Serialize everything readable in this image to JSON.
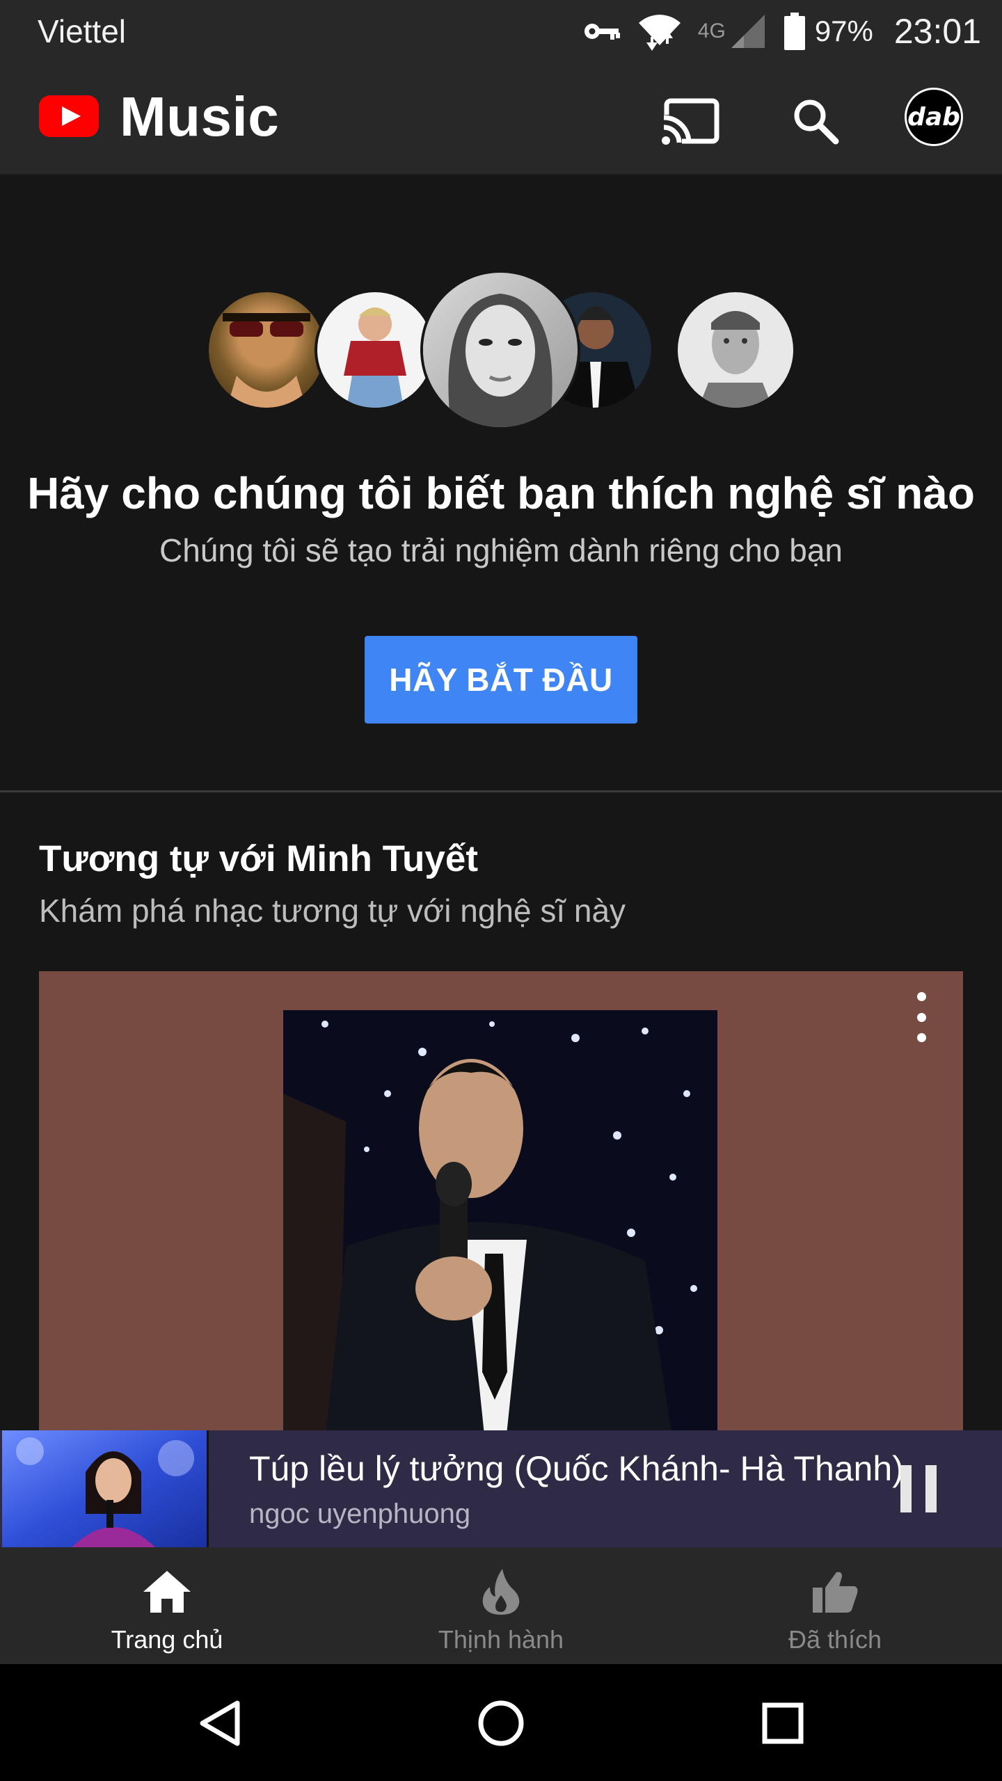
{
  "status_bar": {
    "carrier": "Viettel",
    "network": "4G",
    "battery": "97%",
    "time": "23:01",
    "icons": [
      "vpn-key-icon",
      "wifi-icon",
      "signal-icon",
      "battery-icon"
    ]
  },
  "app_bar": {
    "title": "Music",
    "logo": "youtube-play-icon",
    "actions": [
      "cast-icon",
      "search-icon"
    ],
    "avatar_text": "dab"
  },
  "hero": {
    "title": "Hãy cho chúng tôi biết bạn thích nghệ sĩ nào",
    "subtitle": "Chúng tôi sẽ tạo trải nghiệm dành riêng cho bạn",
    "start_button": "HÃY BẮT ĐẦU",
    "artist_avatars": 5
  },
  "section": {
    "title": "Tương tự với Minh Tuyết",
    "subtitle": "Khám phá nhạc tương tự với nghệ sĩ này",
    "card_color": "#774b41"
  },
  "mini_player": {
    "title": "Túp lều lý tưởng (Quốc Khánh- Hà Thanh)",
    "artist": "ngoc uyenphuong",
    "state": "playing"
  },
  "bottom_nav": {
    "items": [
      {
        "label": "Trang chủ",
        "icon": "home-icon",
        "active": true
      },
      {
        "label": "Thịnh hành",
        "icon": "fire-icon",
        "active": false
      },
      {
        "label": "Đã thích",
        "icon": "thumb-up-icon",
        "active": false
      }
    ]
  },
  "colors": {
    "accent": "#3f85f4",
    "youtube_red": "#ff0000",
    "background": "#161616",
    "bar": "#282828",
    "mini_player": "#2f2b47"
  }
}
